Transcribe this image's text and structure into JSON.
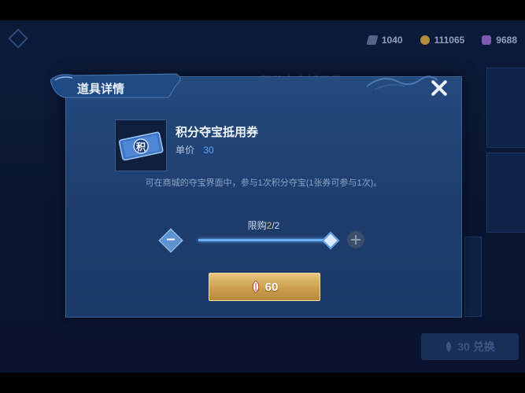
{
  "resources": [
    {
      "icon": "diamond-currency-icon",
      "value": "1040"
    },
    {
      "icon": "gold-coin-icon",
      "value": "111065"
    },
    {
      "icon": "gem-currency-icon",
      "value": "9688"
    }
  ],
  "background": {
    "title": "积分夺宝抵用券",
    "exchange_button": "30 兑换"
  },
  "dialog": {
    "title": "道具详情",
    "item_name": "积分夺宝抵用券",
    "item_icon_glyph": "积",
    "price_label": "单价",
    "price_value": "30",
    "description": "可在商城的夺宝界面中，参与1次积分夺宝(1张券可参与1次)。",
    "limit_label": "限购",
    "limit_current": "2",
    "limit_total": "/2",
    "quantity_fraction": 1.0,
    "buy_value": "60"
  },
  "colors": {
    "accent": "#5aa6ff",
    "gold": "#cc9f4f",
    "limit_highlight": "#e0b45a"
  }
}
